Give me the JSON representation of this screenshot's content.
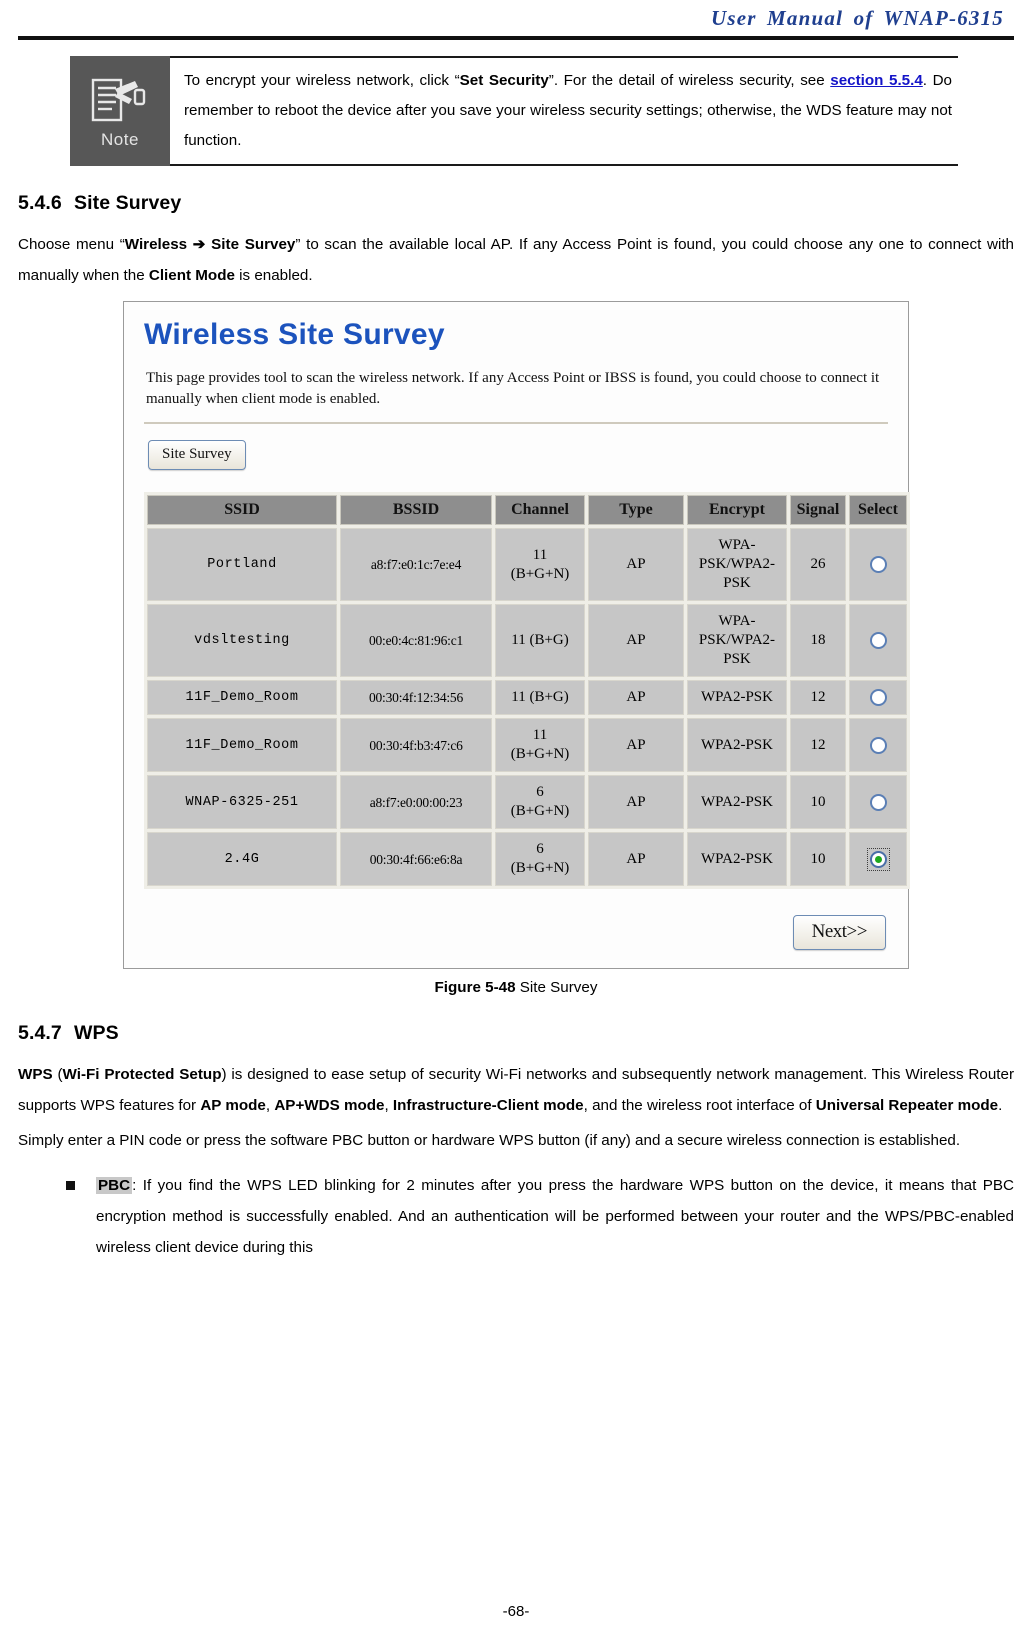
{
  "header": {
    "title": "User  Manual  of  WNAP-6315"
  },
  "note": {
    "icon_label": "Note",
    "text_before_link_1": "To encrypt your wireless network, click “",
    "bold_1": "Set Security",
    "text_after_1": "”. For the detail of wireless security, see ",
    "link": "section 5.5.4",
    "text_after_link": ". Do remember to reboot the device after you save your wireless security settings; otherwise, the WDS feature may not function."
  },
  "section_site_survey": {
    "number": "5.4.6",
    "title": "Site Survey",
    "para_1_a": "Choose menu “",
    "para_1_bold": "Wireless ➔ Site Survey",
    "para_1_b": "” to scan the available local AP. If any Access Point is found, you could choose any one to connect with manually when the ",
    "para_1_bold_2": "Client Mode",
    "para_1_c": " is enabled."
  },
  "figure": {
    "ui_title": "Wireless Site Survey",
    "ui_desc": "This page provides tool to scan the wireless network. If any Access Point or IBSS is found, you could choose to connect it manually when client mode is enabled.",
    "site_survey_button": "Site Survey",
    "next_button": "Next>>",
    "columns": [
      "SSID",
      "BSSID",
      "Channel",
      "Type",
      "Encrypt",
      "Signal",
      "Select"
    ],
    "rows": [
      {
        "ssid": "Portland",
        "bssid": "a8:f7:e0:1c:7e:e4",
        "channel": "11\n(B+G+N)",
        "type": "AP",
        "encrypt": "WPA-PSK/WPA2-PSK",
        "signal": "26",
        "selected": false
      },
      {
        "ssid": "vdsltesting",
        "bssid": "00:e0:4c:81:96:c1",
        "channel": "11 (B+G)",
        "type": "AP",
        "encrypt": "WPA-PSK/WPA2-PSK",
        "signal": "18",
        "selected": false
      },
      {
        "ssid": "11F_Demo_Room",
        "bssid": "00:30:4f:12:34:56",
        "channel": "11 (B+G)",
        "type": "AP",
        "encrypt": "WPA2-PSK",
        "signal": "12",
        "selected": false
      },
      {
        "ssid": "11F_Demo_Room",
        "bssid": "00:30:4f:b3:47:c6",
        "channel": "11\n(B+G+N)",
        "type": "AP",
        "encrypt": "WPA2-PSK",
        "signal": "12",
        "selected": false
      },
      {
        "ssid": "WNAP-6325-251",
        "bssid": "a8:f7:e0:00:00:23",
        "channel": "6\n(B+G+N)",
        "type": "AP",
        "encrypt": "WPA2-PSK",
        "signal": "10",
        "selected": false
      },
      {
        "ssid": "2.4G",
        "bssid": "00:30:4f:66:e6:8a",
        "channel": "6\n(B+G+N)",
        "type": "AP",
        "encrypt": "WPA2-PSK",
        "signal": "10",
        "selected": true
      }
    ],
    "caption_bold": "Figure 5-48",
    "caption_rest": " Site Survey"
  },
  "section_wps": {
    "number": "5.4.7",
    "title": "WPS",
    "para_1_b1": "WPS",
    "para_1_t1": " (",
    "para_1_b2": "Wi-Fi Protected Setup",
    "para_1_t2": ") is designed to ease setup of security Wi-Fi networks and subsequently network management. This Wireless Router supports WPS features for ",
    "para_1_b3": "AP mode",
    "para_1_t3": ", ",
    "para_1_b4": "AP+WDS mode",
    "para_1_t4": ", ",
    "para_1_b5": "Infrastructure-Client mode",
    "para_1_t5": ", and the wireless root interface of ",
    "para_1_b6": "Universal Repeater mode",
    "para_1_t6": ".",
    "para_2": "Simply enter a PIN code or press the software PBC button or hardware WPS button (if any) and a secure wireless connection is established.",
    "bullet_label": "PBC",
    "bullet_text": ": If you find the WPS LED blinking for 2 minutes after you press the hardware WPS button on the device, it means that PBC encryption method is successfully enabled. And an authentication will be performed between your router and the WPS/PBC-enabled wireless client device during this"
  },
  "footer": {
    "page_number": "-68-"
  },
  "colors": {
    "header_blue": "#1f3f8f",
    "ui_title_blue": "#1c53bd",
    "link_blue": "#1414c8",
    "note_bg": "#575757",
    "table_header_gray": "#8e8e8e",
    "table_cell_gray": "#c6c6c6",
    "radio_selected_green": "#1fa81f"
  }
}
